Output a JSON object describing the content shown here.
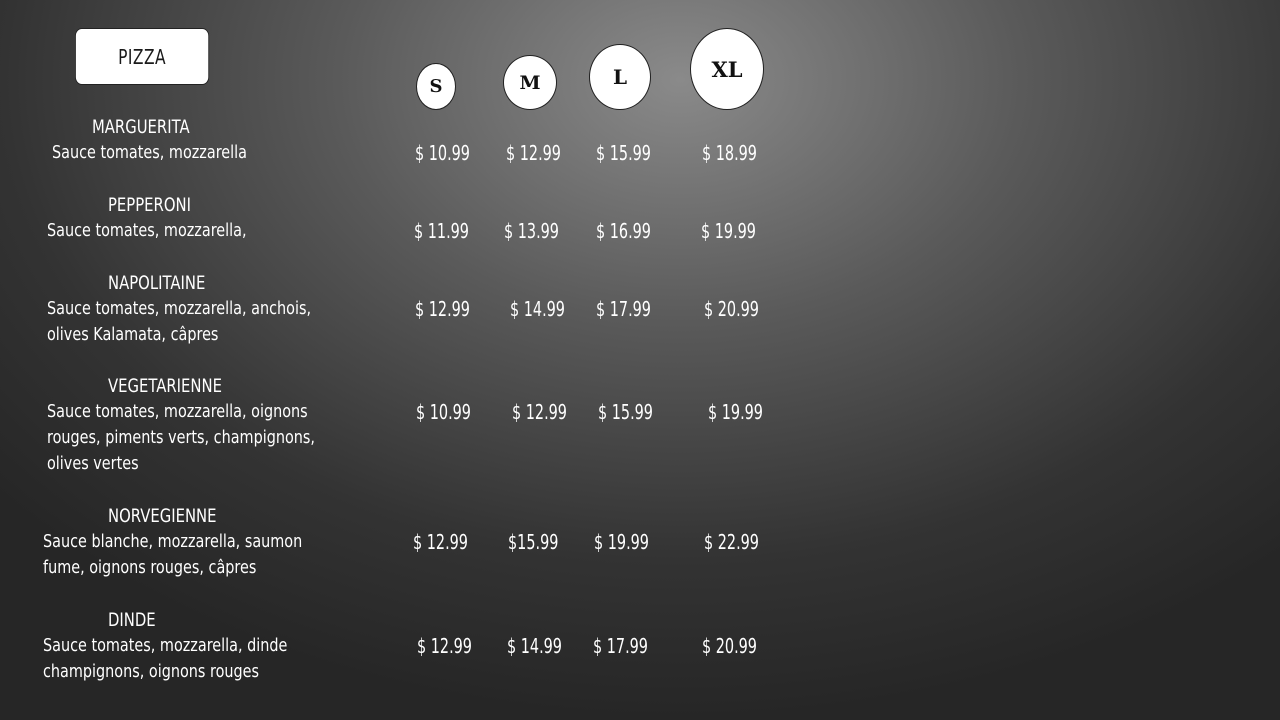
{
  "menu": {
    "title": "PIZZA",
    "sizes": [
      "S",
      "M",
      "L",
      "XL"
    ],
    "items": [
      {
        "name": "MARGUERITA",
        "description": [
          "Sauce tomates, mozzarella"
        ],
        "prices": [
          "$ 10.99",
          "$ 12.99",
          "$ 15.99",
          "$ 18.99"
        ]
      },
      {
        "name": "PEPPERONI",
        "description": [
          "Sauce tomates, mozzarella,"
        ],
        "prices": [
          "$ 11.99",
          "$ 13.99",
          "$ 16.99",
          "$ 19.99"
        ]
      },
      {
        "name": "NAPOLITAINE",
        "description": [
          "Sauce tomates, mozzarella, anchois,",
          "olives Kalamata, câpres"
        ],
        "prices": [
          "$ 12.99",
          "$ 14.99",
          "$ 17.99",
          "$ 20.99"
        ]
      },
      {
        "name": "VEGETARIENNE",
        "description": [
          "Sauce tomates, mozzarella, oignons",
          "rouges, piments verts, champignons,",
          "olives vertes"
        ],
        "prices": [
          "$ 10.99",
          "$ 12.99",
          "$ 15.99",
          "$ 19.99"
        ]
      },
      {
        "name": "NORVEGIENNE",
        "description": [
          "Sauce blanche, mozzarella, saumon",
          "fume, oignons rouges, câpres"
        ],
        "prices": [
          "$ 12.99",
          "$15.99",
          "$ 19.99",
          "$ 22.99"
        ]
      },
      {
        "name": "DINDE",
        "description": [
          "Sauce tomates, mozzarella, dinde",
          "champignons, oignons rouges"
        ],
        "prices": [
          "$ 12.99",
          "$ 14.99",
          "$ 17.99",
          "$ 20.99"
        ]
      }
    ]
  }
}
